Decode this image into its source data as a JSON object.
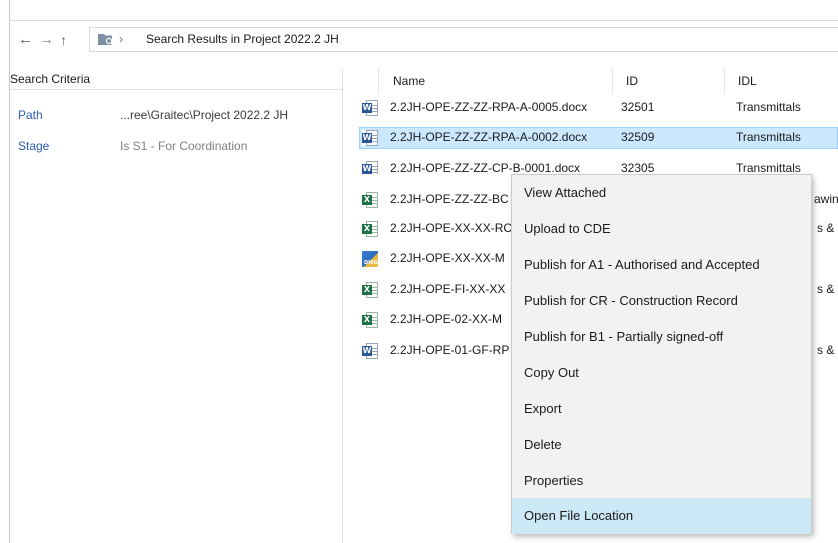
{
  "nav": {
    "back_glyph": "←",
    "forward_glyph": "→",
    "up_glyph": "↑",
    "chevron": "›",
    "address_text": "Search Results in  Project 2022.2 JH"
  },
  "criteria": {
    "header": "Search Criteria",
    "rows": [
      {
        "key": "Path",
        "value": "...ree\\Graitec\\Project 2022.2 JH"
      },
      {
        "key": "Stage",
        "value": "Is  S1 - For Coordination"
      }
    ]
  },
  "columns": {
    "name": "Name",
    "id": "ID",
    "idl": "IDL"
  },
  "files": [
    {
      "icon": "word",
      "name": "2.2JH-OPE-ZZ-ZZ-RPA-A-0005.docx",
      "id": "32501",
      "idl": "Transmittals"
    },
    {
      "icon": "word",
      "name": "2.2JH-OPE-ZZ-ZZ-RPA-A-0002.docx",
      "id": "32509",
      "idl": "Transmittals"
    },
    {
      "icon": "word",
      "name": "2.2JH-OPE-ZZ-ZZ-CP-B-0001.docx",
      "id": "32305",
      "idl": "Transmittals"
    },
    {
      "icon": "excel",
      "name": "2.2JH-OPE-ZZ-ZZ-BC",
      "idl_tail": "awin"
    },
    {
      "icon": "excel",
      "name": "2.2JH-OPE-XX-XX-RC",
      "idl_tail": "s & I"
    },
    {
      "icon": "dwg",
      "name": "2.2JH-OPE-XX-XX-M"
    },
    {
      "icon": "excel",
      "name": "2.2JH-OPE-FI-XX-XX",
      "idl_tail": "s & I"
    },
    {
      "icon": "excel",
      "name": "2.2JH-OPE-02-XX-M"
    },
    {
      "icon": "word",
      "name": "2.2JH-OPE-01-GF-RP",
      "idl_tail": "s & I"
    }
  ],
  "menu": {
    "items": [
      "View Attached",
      "Upload to CDE",
      "Publish for A1 - Authorised and Accepted",
      "Publish for CR - Construction Record",
      "Publish for B1 - Partially signed-off",
      "Copy Out",
      "Export",
      "Delete",
      "Properties",
      "Open File Location"
    ],
    "hovered": "Open File Location"
  },
  "colors": {
    "selection": "#cce8ff",
    "menu_hover": "#cde8f7",
    "link_blue": "#2b5fb0"
  }
}
